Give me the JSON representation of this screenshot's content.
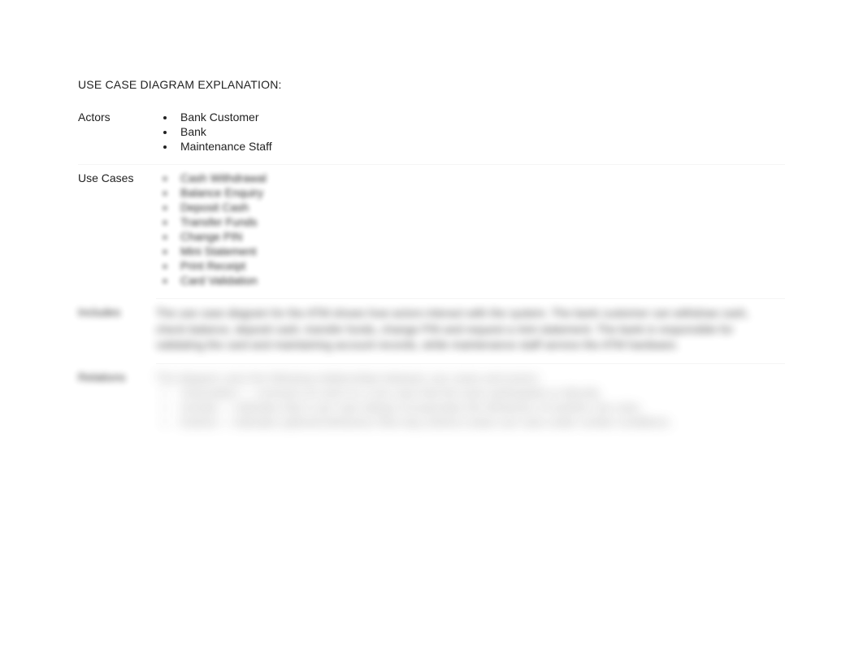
{
  "title": "USE CASE DIAGRAM EXPLANATION:",
  "rows": {
    "actors": {
      "label": "Actors",
      "items": [
        "Bank Customer",
        "Bank",
        "Maintenance Staff"
      ]
    },
    "use_cases": {
      "label": "Use Cases",
      "items": [
        "Cash Withdrawal",
        "Balance Enquiry",
        "Deposit Cash",
        "Transfer Funds",
        "Change PIN",
        "Mini Statement",
        "Print Receipt",
        "Card Validation"
      ]
    },
    "includes": {
      "label": "Includes",
      "text": "The use case diagram for the ATM shows how actors interact with the system. The bank customer can withdraw cash, check balance, deposit cash, transfer funds, change PIN and request a mini statement. The bank is responsible for validating the card and maintaining account records, while maintenance staff service the ATM hardware."
    },
    "relations": {
      "label": "Relations",
      "intro": "The diagram uses the following relationships between use cases and actors:",
      "items": [
        "Association — connects an actor to a use case that the actor participates in directly.",
        "Include — indicates that a use case always incorporates the behaviour of another use case.",
        "Extend — indicates optional behaviour that may extend a base use case under certain conditions."
      ]
    }
  }
}
